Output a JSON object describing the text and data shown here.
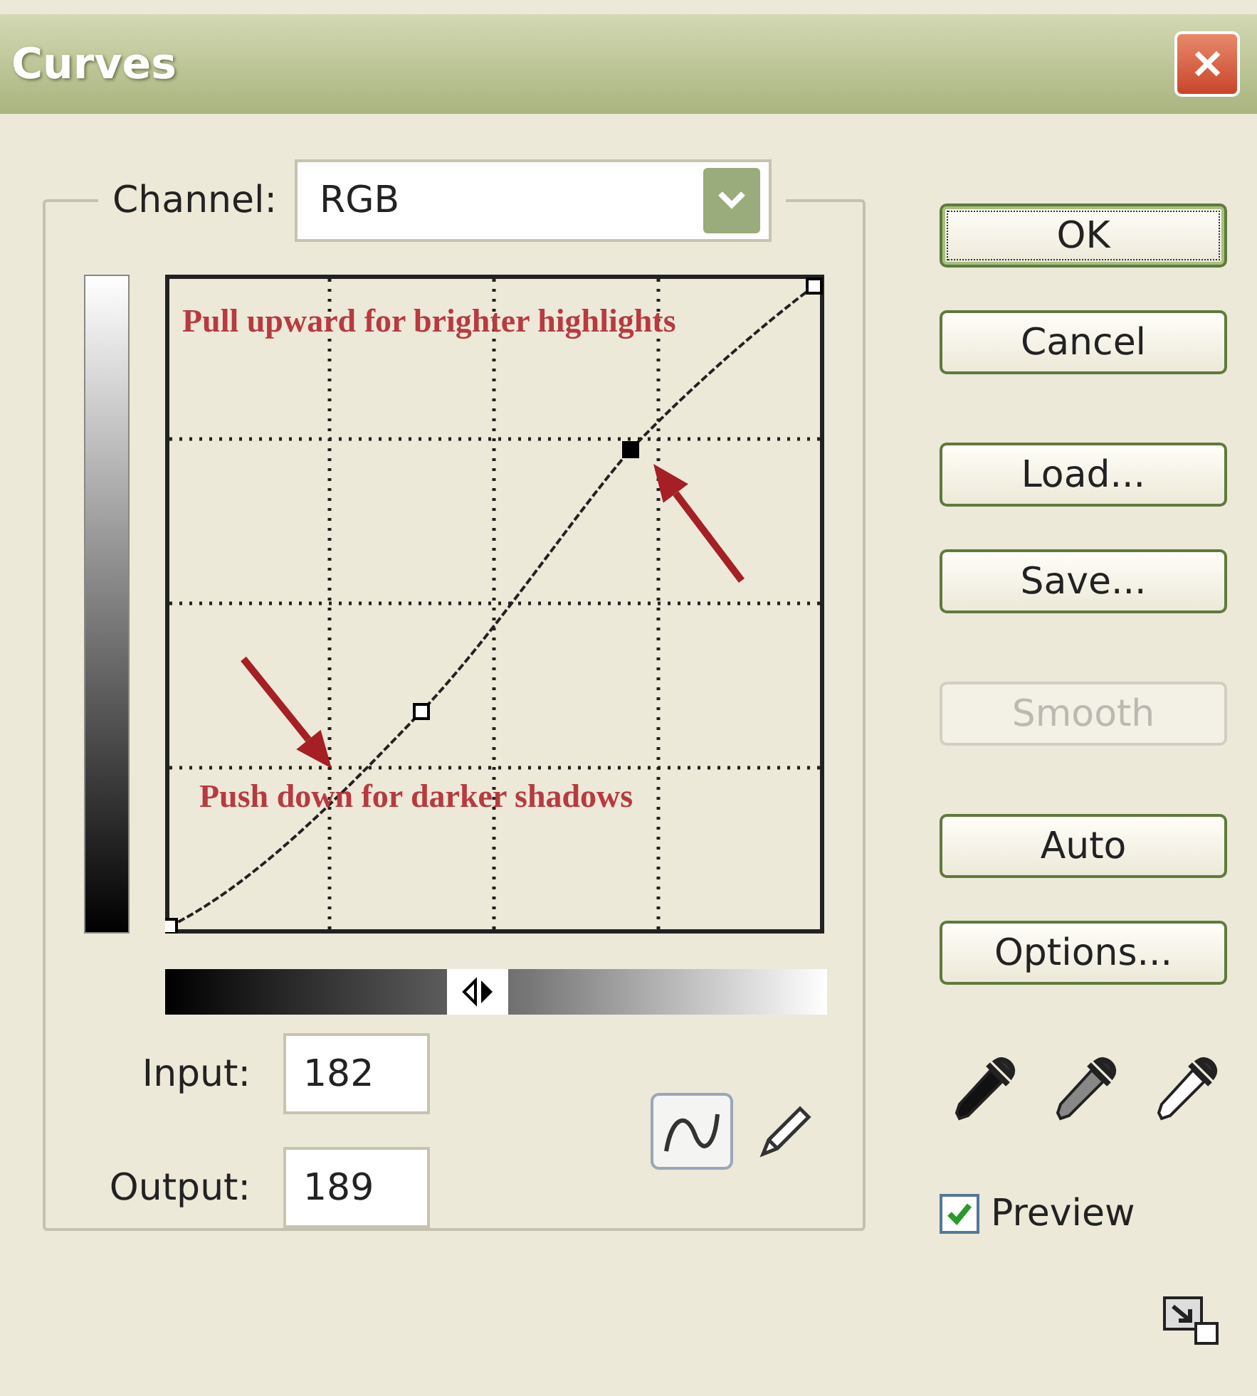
{
  "window": {
    "title": "Curves",
    "close_label": "✕"
  },
  "channel": {
    "label": "Channel:",
    "value": "RGB"
  },
  "graph": {
    "annotations": [
      "Pull upward for brighter highlights",
      "Push down for darker shadows"
    ],
    "control_points": [
      {
        "selected": false
      },
      {
        "selected": false
      },
      {
        "selected": true
      },
      {
        "selected": false
      }
    ]
  },
  "input_gradient": {
    "level": 0.47
  },
  "fields": [
    {
      "label": "Input:",
      "value": "182"
    },
    {
      "label": "Output:",
      "value": "189"
    }
  ],
  "tools": [
    {
      "kind": "curve",
      "selected": true
    },
    {
      "kind": "pencil",
      "selected": false
    }
  ],
  "button_groups": [
    [
      {
        "label": "OK",
        "default": true,
        "disabled": false
      },
      {
        "label": "Cancel",
        "default": false,
        "disabled": false
      }
    ],
    [
      {
        "label": "Load...",
        "default": false,
        "disabled": false
      },
      {
        "label": "Save...",
        "default": false,
        "disabled": false
      }
    ],
    [
      {
        "label": "Smooth",
        "default": false,
        "disabled": true
      }
    ],
    [
      {
        "label": "Auto",
        "default": false,
        "disabled": false
      },
      {
        "label": "Options...",
        "default": false,
        "disabled": false
      }
    ]
  ],
  "eyedroppers": [
    {
      "kind": "black"
    },
    {
      "kind": "gray"
    },
    {
      "kind": "white"
    }
  ],
  "preview": {
    "label": "Preview",
    "checked": true
  }
}
